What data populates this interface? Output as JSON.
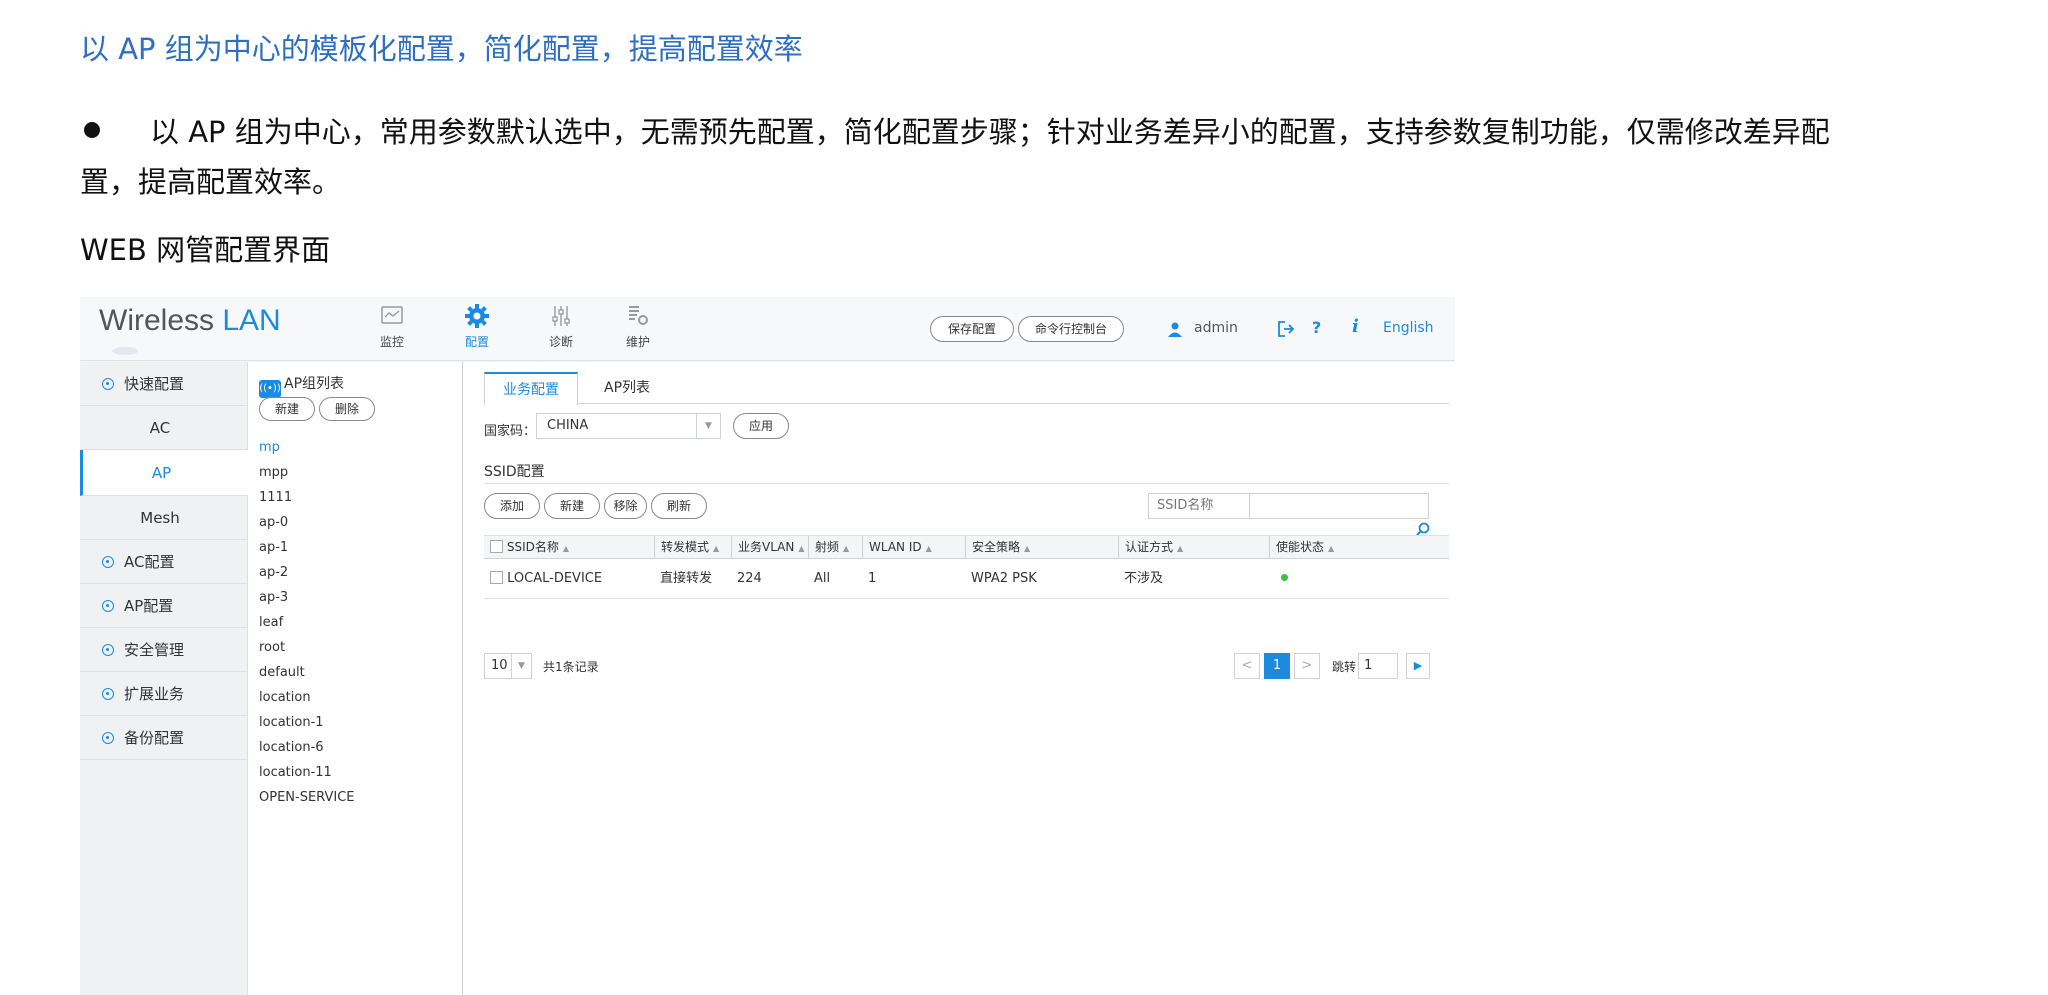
{
  "doc": {
    "title": "以 AP 组为中心的模板化配置，简化配置，提高配置效率",
    "bullet": "以 AP 组为中心，常用参数默认选中，无需预先配置，简化配置步骤；针对业务差异小的配置，支持参数复制功能，仅需修改差异配置，提高配置效率。",
    "subtitle": "WEB 网管配置界面"
  },
  "app": {
    "logo_main": "Wireless ",
    "logo_accent": "LAN",
    "accent_color": "#1a8be0",
    "nav": [
      {
        "label": "监控",
        "icon": "monitor-icon"
      },
      {
        "label": "配置",
        "icon": "gear-icon"
      },
      {
        "label": "诊断",
        "icon": "sliders-icon"
      },
      {
        "label": "维护",
        "icon": "maintenance-icon"
      }
    ],
    "save_config": "保存配置",
    "cli_console": "命令行控制台",
    "user": "admin",
    "help": "?",
    "info": "i",
    "language": "English"
  },
  "leftnav": {
    "quick_config": "快速配置",
    "subitems": [
      "AC",
      "AP",
      "Mesh"
    ],
    "sections": [
      "AC配置",
      "AP配置",
      "安全管理",
      "扩展业务",
      "备份配置"
    ]
  },
  "apgroups": {
    "heading": "AP组列表",
    "new_button": "新建",
    "delete_button": "删除",
    "items": [
      "mp",
      "mpp",
      "1111",
      "ap-0",
      "ap-1",
      "ap-2",
      "ap-3",
      "leaf",
      "root",
      "default",
      "location",
      "location-1",
      "location-6",
      "location-11",
      "OPEN-SERVICE"
    ]
  },
  "main": {
    "tabs": [
      "业务配置",
      "AP列表"
    ],
    "country_label": "国家码：",
    "country_value": "CHINA",
    "apply_button": "应用",
    "ssid_title": "SSID配置",
    "buttons": [
      "添加",
      "新建",
      "移除",
      "刷新"
    ],
    "search_placeholder": "SSID名称",
    "columns": [
      "SSID名称",
      "转发模式",
      "业务VLAN",
      "射频",
      "WLAN ID",
      "安全策略",
      "认证方式",
      "使能状态"
    ],
    "rows": [
      {
        "ssid": "LOCAL-DEVICE",
        "forward": "直接转发",
        "vlan": "224",
        "radio": "All",
        "wlan_id": "1",
        "security": "WPA2 PSK",
        "auth": "不涉及",
        "enabled": "green"
      }
    ],
    "page_size": "10",
    "total": "共1条记录",
    "prev": "<",
    "current_page": "1",
    "next": ">",
    "jump_label": "跳转",
    "jump_value": "1"
  }
}
